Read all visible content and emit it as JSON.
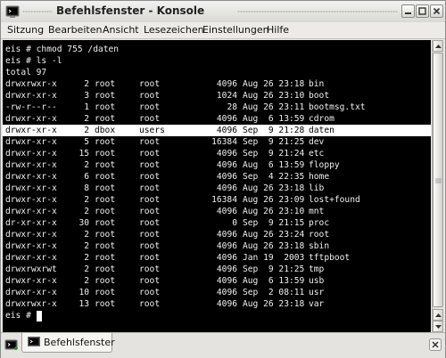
{
  "window": {
    "title": "Befehlsfenster - Konsole"
  },
  "menu": {
    "items": [
      "Sitzung",
      "Bearbeiten",
      "Ansicht",
      "Lesezeichen",
      "Einstellungen",
      "Hilfe"
    ]
  },
  "terminal": {
    "prompt_lines": [
      "eis # chmod 755 /daten",
      "eis # ls -l",
      "total 97"
    ],
    "listing": [
      {
        "perm": "drwxrwxr-x",
        "links": "2",
        "owner": "root",
        "group": "root",
        "size": "4096",
        "date": "Aug 26 23:18",
        "name": "bin"
      },
      {
        "perm": "drwxr-xr-x",
        "links": "3",
        "owner": "root",
        "group": "root",
        "size": "1024",
        "date": "Aug 26 23:10",
        "name": "boot"
      },
      {
        "perm": "-rw-r--r--",
        "links": "1",
        "owner": "root",
        "group": "root",
        "size": "28",
        "date": "Aug 26 23:11",
        "name": "bootmsg.txt"
      },
      {
        "perm": "drwxr-xr-x",
        "links": "2",
        "owner": "root",
        "group": "root",
        "size": "4096",
        "date": "Aug  6 13:59",
        "name": "cdrom"
      },
      {
        "perm": "drwxr-xr-x",
        "links": "2",
        "owner": "dbox",
        "group": "users",
        "size": "4096",
        "date": "Sep  9 21:28",
        "name": "daten"
      },
      {
        "perm": "drwxr-xr-x",
        "links": "5",
        "owner": "root",
        "group": "root",
        "size": "16384",
        "date": "Sep  9 21:25",
        "name": "dev"
      },
      {
        "perm": "drwxr-xr-x",
        "links": "15",
        "owner": "root",
        "group": "root",
        "size": "4096",
        "date": "Sep  9 21:24",
        "name": "etc"
      },
      {
        "perm": "drwxr-xr-x",
        "links": "2",
        "owner": "root",
        "group": "root",
        "size": "4096",
        "date": "Aug  6 13:59",
        "name": "floppy"
      },
      {
        "perm": "drwxr-xr-x",
        "links": "6",
        "owner": "root",
        "group": "root",
        "size": "4096",
        "date": "Sep  4 22:35",
        "name": "home"
      },
      {
        "perm": "drwxr-xr-x",
        "links": "8",
        "owner": "root",
        "group": "root",
        "size": "4096",
        "date": "Aug 26 23:18",
        "name": "lib"
      },
      {
        "perm": "drwxr-xr-x",
        "links": "2",
        "owner": "root",
        "group": "root",
        "size": "16384",
        "date": "Aug 26 23:09",
        "name": "lost+found"
      },
      {
        "perm": "drwxr-xr-x",
        "links": "2",
        "owner": "root",
        "group": "root",
        "size": "4096",
        "date": "Aug 26 23:10",
        "name": "mnt"
      },
      {
        "perm": "dr-xr-xr-x",
        "links": "30",
        "owner": "root",
        "group": "root",
        "size": "0",
        "date": "Sep  9 21:15",
        "name": "proc"
      },
      {
        "perm": "drwxr-xr-x",
        "links": "2",
        "owner": "root",
        "group": "root",
        "size": "4096",
        "date": "Aug 26 23:24",
        "name": "root"
      },
      {
        "perm": "drwxr-xr-x",
        "links": "2",
        "owner": "root",
        "group": "root",
        "size": "4096",
        "date": "Aug 26 23:18",
        "name": "sbin"
      },
      {
        "perm": "drwxr-xr-x",
        "links": "2",
        "owner": "root",
        "group": "root",
        "size": "4096",
        "date": "Jan 19  2003",
        "name": "tftpboot"
      },
      {
        "perm": "drwxrwxrwt",
        "links": "2",
        "owner": "root",
        "group": "root",
        "size": "4096",
        "date": "Sep  9 21:25",
        "name": "tmp"
      },
      {
        "perm": "drwxr-xr-x",
        "links": "2",
        "owner": "root",
        "group": "root",
        "size": "4096",
        "date": "Aug  6 13:59",
        "name": "usb"
      },
      {
        "perm": "drwxr-xr-x",
        "links": "10",
        "owner": "root",
        "group": "root",
        "size": "4096",
        "date": "Sep  2 08:11",
        "name": "usr"
      },
      {
        "perm": "drwxrwxr-x",
        "links": "13",
        "owner": "root",
        "group": "root",
        "size": "4096",
        "date": "Aug 26 23:18",
        "name": "var"
      }
    ],
    "highlighted_entry": "daten",
    "current_prompt": "eis #"
  },
  "tabs": {
    "items": [
      {
        "label": "Befehlsfenster",
        "icon": "terminal-icon"
      }
    ]
  },
  "icons": {
    "app": "konsole-app-icon",
    "new_tab": "new-session-icon",
    "close_tab": "close-session-icon"
  },
  "colors": {
    "terminal_bg": "#000000",
    "terminal_fg": "#f0f0f0",
    "highlight_bg": "#ffffff"
  }
}
